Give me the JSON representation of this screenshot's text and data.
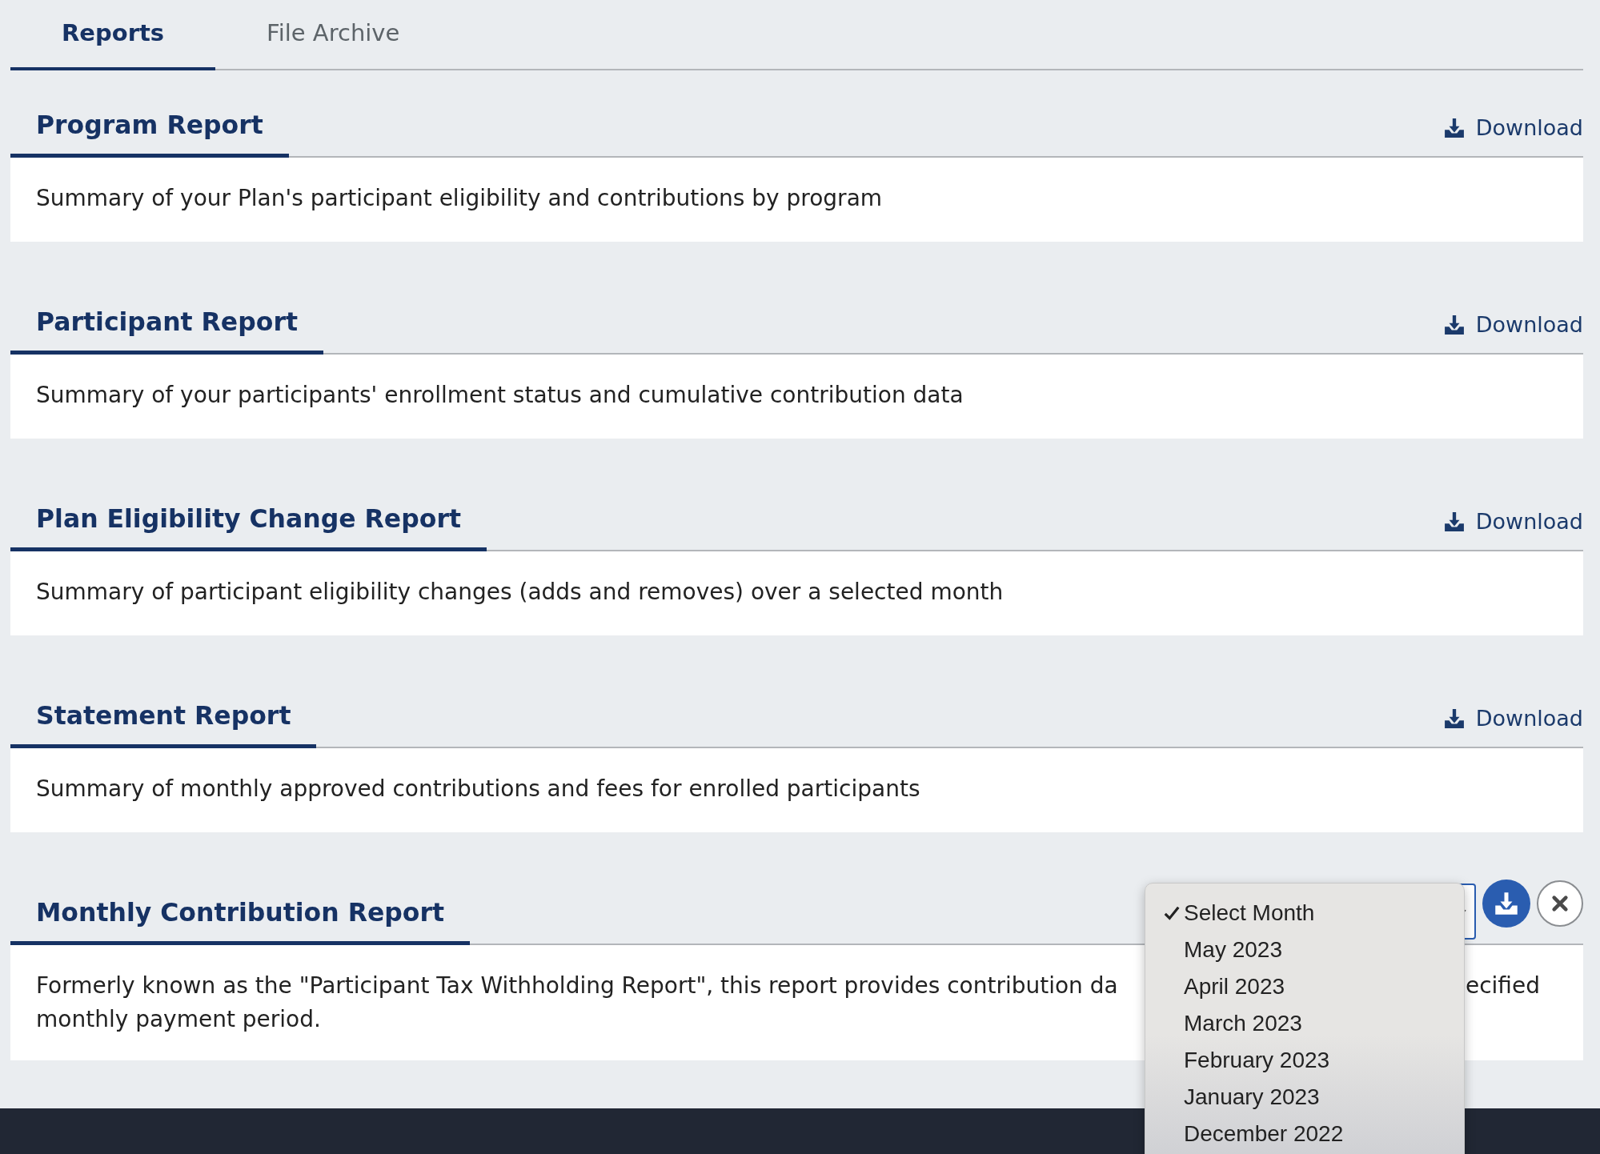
{
  "tabs": [
    {
      "label": "Reports",
      "selected": true
    },
    {
      "label": "File Archive",
      "selected": false
    }
  ],
  "reports": [
    {
      "kind": "download",
      "title": "Program Report",
      "action": "Download",
      "description": "Summary of your Plan's participant eligibility and contributions by program"
    },
    {
      "kind": "download",
      "title": "Participant Report",
      "action": "Download",
      "description": "Summary of your participants' enrollment status and cumulative contribution data"
    },
    {
      "kind": "download",
      "title": "Plan Eligibility Change Report",
      "action": "Download",
      "description": "Summary of participant eligibility changes (adds and removes) over a selected month"
    },
    {
      "kind": "download",
      "title": "Statement Report",
      "action": "Download",
      "description": "Summary of monthly approved contributions and fees for enrolled participants"
    },
    {
      "kind": "month_picker",
      "title": "Monthly Contribution Report",
      "description_lines": [
        [
          "Formerly known as the \"Participant Tax Withholding Report\", this report provides contribution da",
          "ecified"
        ],
        [
          "monthly payment period."
        ]
      ],
      "month_select": {
        "open": true,
        "options": [
          {
            "label": "Select Month",
            "selected": true
          },
          {
            "label": "May 2023",
            "selected": false
          },
          {
            "label": "April 2023",
            "selected": false
          },
          {
            "label": "March 2023",
            "selected": false
          },
          {
            "label": "February 2023",
            "selected": false
          },
          {
            "label": "January 2023",
            "selected": false
          },
          {
            "label": "December 2022",
            "selected": false
          }
        ]
      }
    }
  ]
}
